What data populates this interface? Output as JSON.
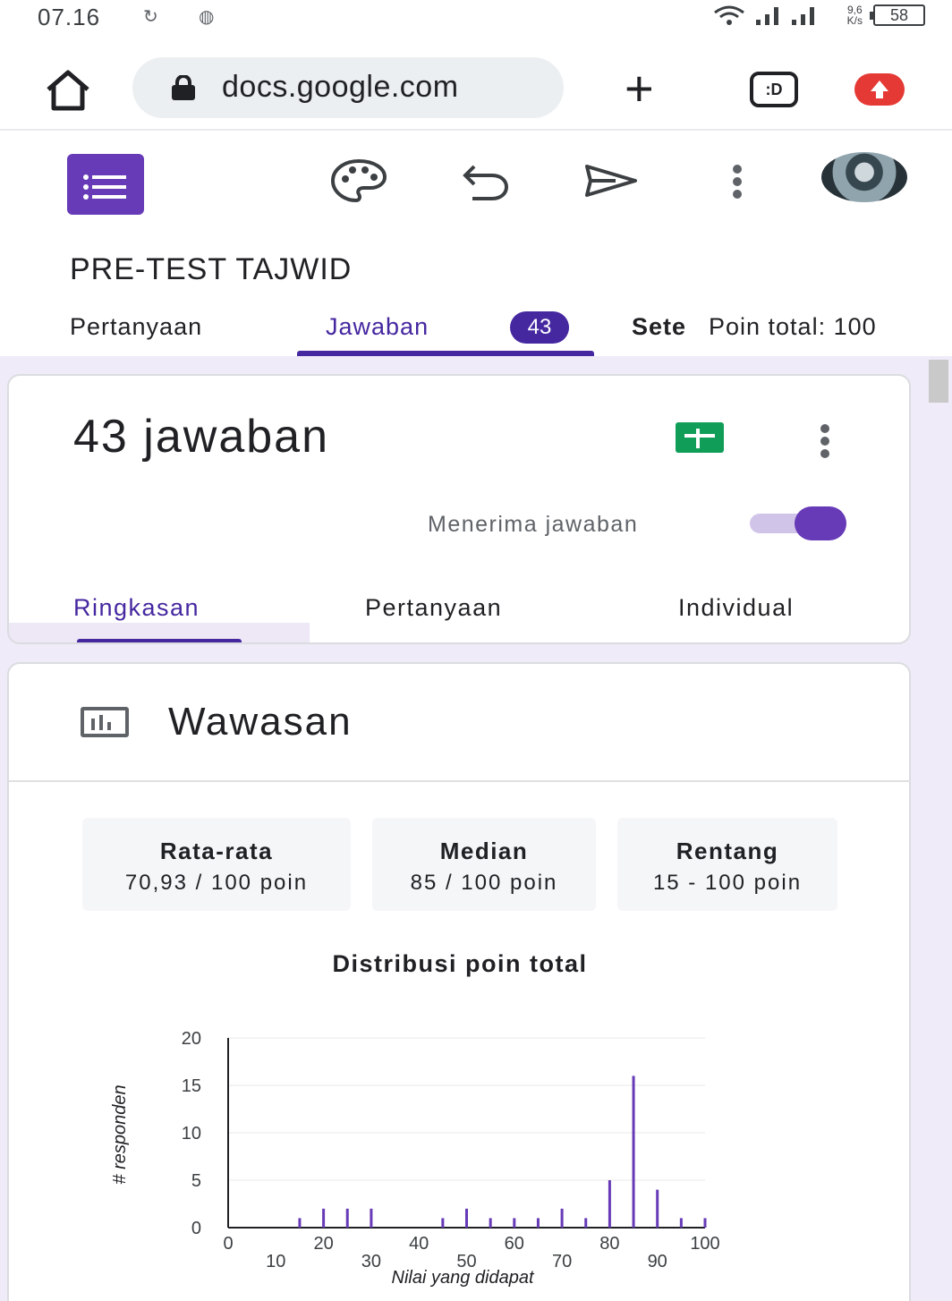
{
  "status_bar": {
    "time": "07.16",
    "speed_value": "9,6",
    "speed_unit": "K/s",
    "battery": "58"
  },
  "browser": {
    "url": "docs.google.com",
    "tabs_label": ":D"
  },
  "form": {
    "title": "PRE-TEST TAJWID",
    "tabs": {
      "questions": "Pertanyaan",
      "responses": "Jawaban",
      "responses_count": "43",
      "settings_partial": "Sete",
      "points_total": "Poin total: 100"
    }
  },
  "responses_card": {
    "count_label": "43 jawaban",
    "accepting_label": "Menerima jawaban",
    "accepting": true,
    "subtabs": {
      "summary": "Ringkasan",
      "question": "Pertanyaan",
      "individual": "Individual"
    }
  },
  "insights": {
    "title": "Wawasan",
    "stats": [
      {
        "label": "Rata-rata",
        "value": "70,93 / 100 poin"
      },
      {
        "label": "Median",
        "value": "85 / 100 poin"
      },
      {
        "label": "Rentang",
        "value": "15 - 100 poin"
      }
    ]
  },
  "chart_data": {
    "type": "bar",
    "title": "Distribusi poin total",
    "xlabel": "Nilai yang didapat",
    "ylabel": "# responden",
    "ylim": [
      0,
      20
    ],
    "xlim": [
      0,
      100
    ],
    "yticks": [
      "0",
      "5",
      "10",
      "15",
      "20"
    ],
    "xticks_upper": [
      "0",
      "20",
      "40",
      "60",
      "80",
      "100"
    ],
    "xticks_lower": [
      "10",
      "30",
      "50",
      "70",
      "90"
    ],
    "x": [
      15,
      20,
      25,
      30,
      45,
      50,
      55,
      60,
      65,
      70,
      75,
      80,
      85,
      90,
      95,
      100
    ],
    "values": [
      1,
      2,
      2,
      2,
      1,
      2,
      1,
      1,
      1,
      2,
      1,
      5,
      16,
      4,
      1,
      1
    ],
    "bar_color": "#673ab7",
    "grid": true
  },
  "colors": {
    "accent": "#4527a0",
    "brand": "#673ab7",
    "background": "#f0ebf8",
    "sheets_green": "#0f9d58"
  }
}
